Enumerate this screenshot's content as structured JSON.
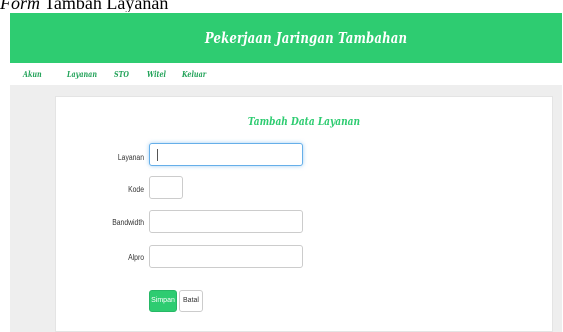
{
  "caption": {
    "prefix": "Form",
    "text": "Tambah Layanan"
  },
  "header": {
    "title": "Pekerjaan Jaringan Tambahan"
  },
  "nav": {
    "items": [
      "Akun",
      "Layanan",
      "STO",
      "Witel",
      "Keluar"
    ]
  },
  "form": {
    "title": "Tambah Data Layanan",
    "fields": [
      {
        "label": "Layanan",
        "value": ""
      },
      {
        "label": "Kode",
        "value": ""
      },
      {
        "label": "Bandwidth",
        "value": ""
      },
      {
        "label": "Alpro",
        "value": ""
      }
    ],
    "submit_label": "Simpan",
    "cancel_label": "Batal"
  },
  "colors": {
    "accent": "#2ecc71",
    "nav_text": "#23a35a",
    "background": "#eeeeee"
  }
}
